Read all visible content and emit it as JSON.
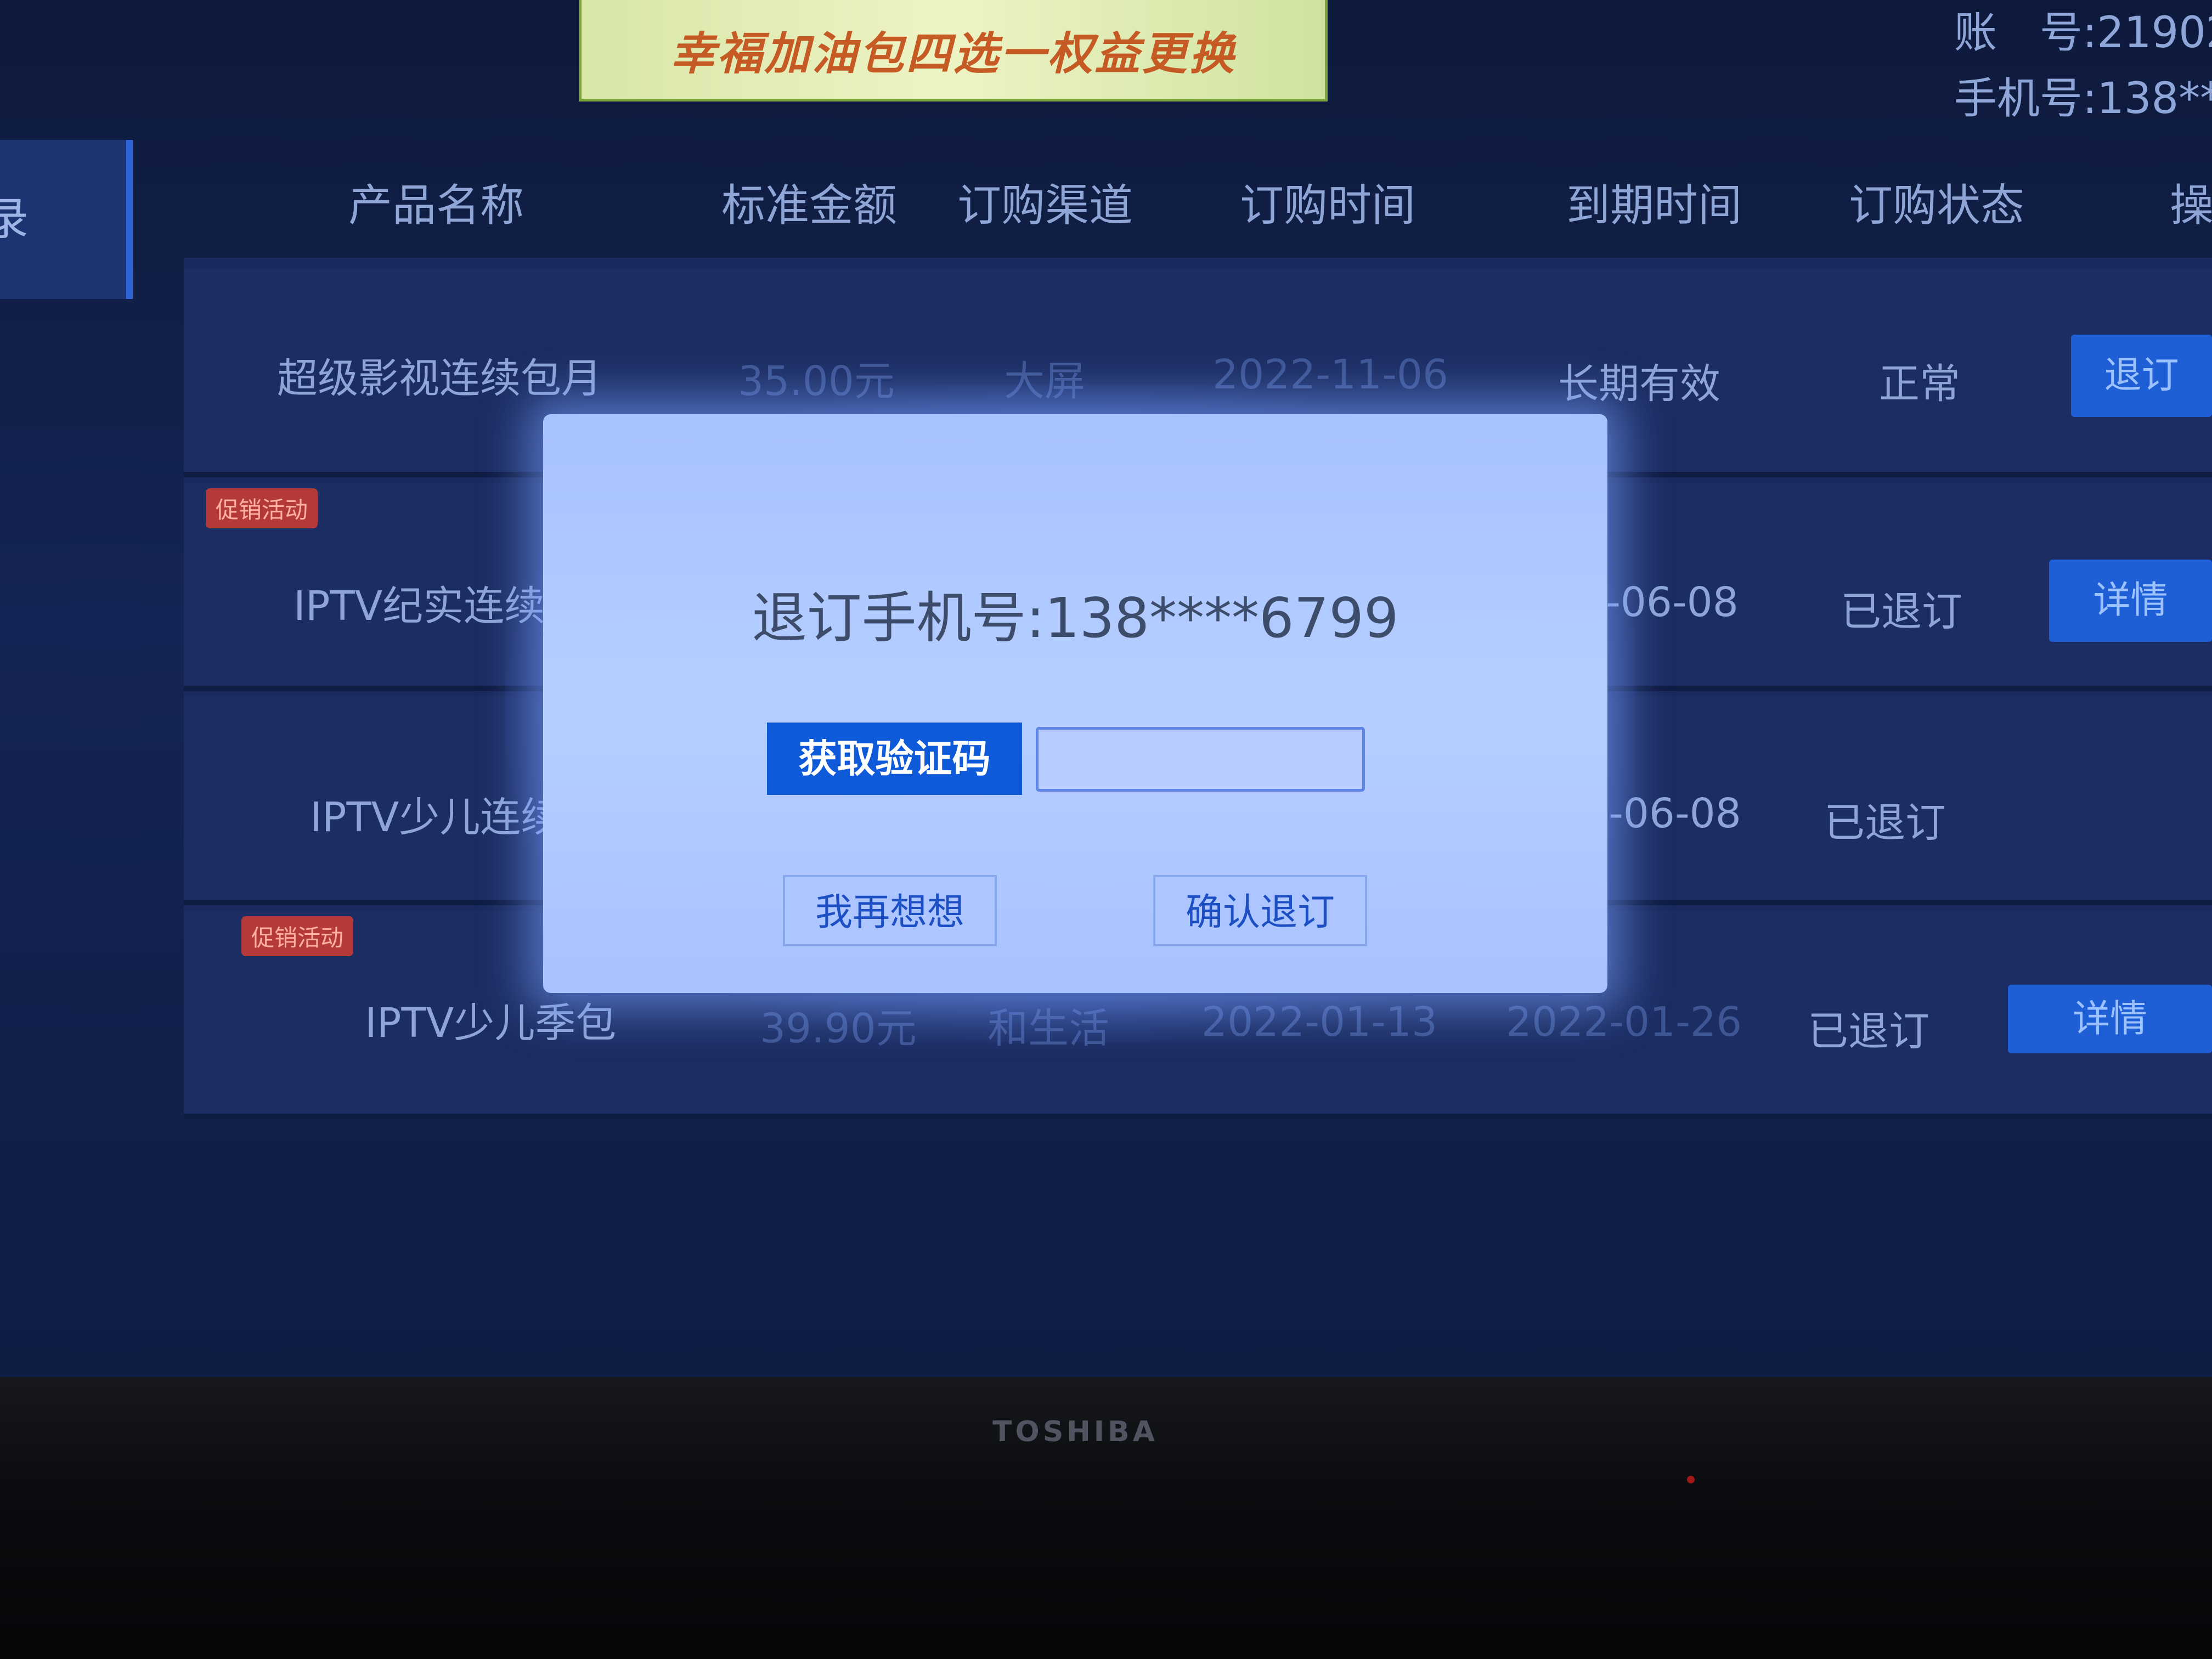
{
  "banner": {
    "text": "幸福加油包四选一权益更换"
  },
  "account": {
    "account_line": "账　号:21902",
    "phone_line": "手机号:138**"
  },
  "sidebar": {
    "active_tab_label": "录"
  },
  "table": {
    "headers": [
      "产品名称",
      "标准金额",
      "订购渠道",
      "订购时间",
      "到期时间",
      "订购状态",
      "操"
    ],
    "rows": [
      {
        "promo": "",
        "name": "超级影视连续包月",
        "amount": "35.00元",
        "channel": "大屏",
        "order_time": "2022-11-06",
        "expire_time": "长期有效",
        "status": "正常",
        "action": "退订"
      },
      {
        "promo": "促销活动",
        "name": "IPTV纪实连续",
        "amount": "",
        "channel": "",
        "order_time": "",
        "expire_time": "2-06-08",
        "status": "已退订",
        "action": "详情"
      },
      {
        "promo": "",
        "name": "IPTV少儿连续",
        "amount": "",
        "channel": "",
        "order_time": "",
        "expire_time": "2-06-08",
        "status": "已退订",
        "action": ""
      },
      {
        "promo": "促销活动",
        "name": "IPTV少儿季包",
        "amount": "39.90元",
        "channel": "和生活",
        "order_time": "2022-01-13",
        "expire_time": "2022-01-26",
        "status": "已退订",
        "action": "详情"
      }
    ]
  },
  "dialog": {
    "title": "退订手机号:138****6799",
    "get_code_label": "获取验证码",
    "code_input_value": "",
    "cancel_label": "我再想想",
    "confirm_label": "确认退订"
  },
  "tv": {
    "brand": "TOSHIBA"
  },
  "colors": {
    "accent": "#0f5ad8",
    "dialog_bg": "#a6c2ff",
    "screen_bg": "#142454",
    "promo": "#b43a3a"
  }
}
